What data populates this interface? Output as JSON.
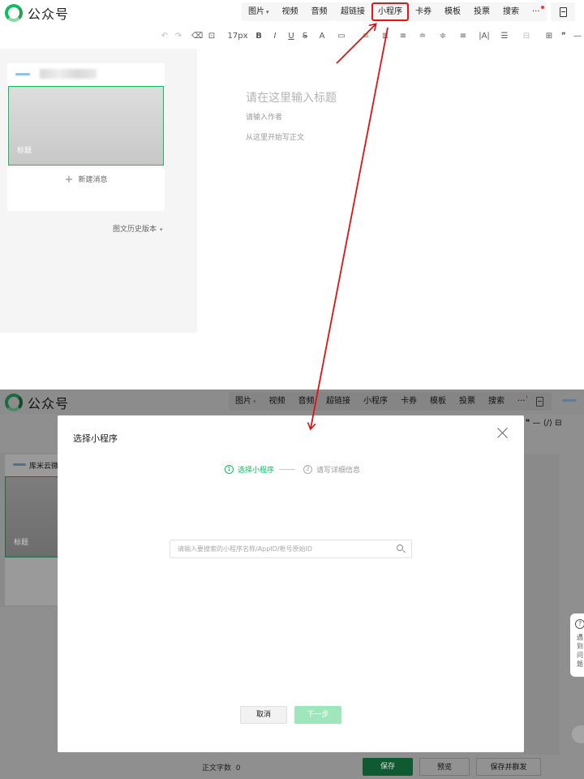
{
  "top": {
    "logo": {
      "text": "公众号"
    },
    "toolbar_group1": [
      {
        "label": "图片",
        "has_caret": true
      },
      {
        "label": "视频"
      },
      {
        "label": "音频"
      }
    ],
    "toolbar_group2": [
      {
        "label": "超链接"
      },
      {
        "label": "小程序",
        "highlighted": true
      },
      {
        "label": "卡券"
      },
      {
        "label": "模板"
      },
      {
        "label": "投票"
      },
      {
        "label": "搜索"
      },
      {
        "label": "···",
        "red_dot": true
      }
    ],
    "format_bar": {
      "font_size": "17px",
      "items": [
        "↶",
        "↷",
        "⌫",
        "⊡",
        "17px",
        "B",
        "I",
        "U",
        "S",
        "A",
        "▭",
        "≡",
        "≣",
        "≡",
        "≐",
        "≑",
        "≡",
        "|A|",
        "☰",
        "⊟",
        "⊞",
        "❞",
        "—"
      ]
    },
    "card": {
      "cover_label": "标题",
      "new_message": "新建消息"
    },
    "history": "图文历史版本",
    "editor": {
      "title_placeholder": "请在这里输入标题",
      "author_placeholder": "请输入作者",
      "body_placeholder": "从这里开始写正文"
    }
  },
  "bottom": {
    "logo": {
      "text": "公众号"
    },
    "toolbar_group1": [
      "图片",
      "视频",
      "音频"
    ],
    "toolbar_group2": [
      "超链接",
      "小程序",
      "卡券",
      "模板",
      "投票",
      "搜索",
      "···"
    ],
    "format_right": "❞ — ⟨/⟩ ⊟",
    "account_name": "库米云微信",
    "cover_label": "标题",
    "help_text": "遇到问题",
    "footer": {
      "word_count_label": "正文字数",
      "word_count": "0",
      "save": "保存",
      "preview": "预览",
      "publish": "保存并群发"
    },
    "modal": {
      "title": "选择小程序",
      "step1_num": "1",
      "step1": "选择小程序",
      "step2_num": "2",
      "step2": "请写详细信息",
      "search_placeholder": "请输入要搜索的小程序名称/AppID/帐号原始ID",
      "cancel": "取消",
      "next": "下一步"
    }
  },
  "colors": {
    "accent": "#07c160",
    "annotation": "#e11111"
  }
}
